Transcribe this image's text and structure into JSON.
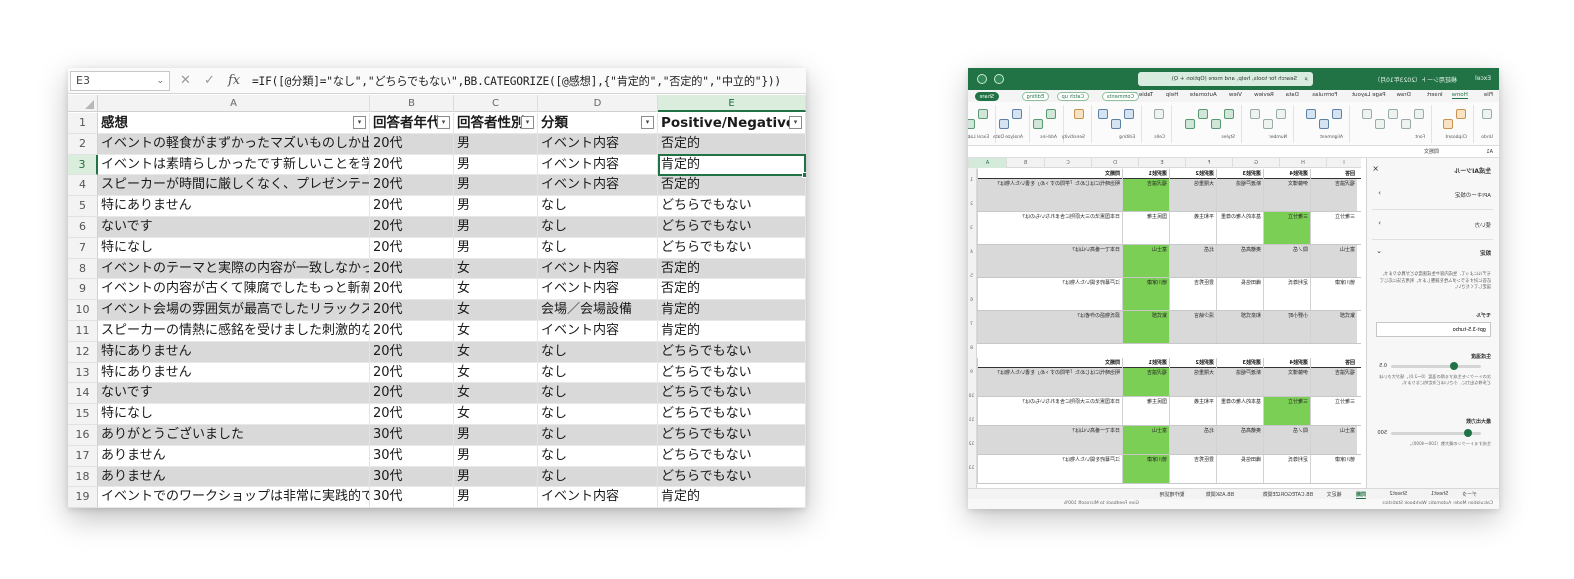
{
  "left": {
    "name_box": "E3",
    "formula_icons": [
      "cancel-icon",
      "enter-check-icon",
      "function-icon"
    ],
    "fx_label": "fx",
    "formula": "=IF([@分類]=\"なし\",\"どちらでもない\",BB.CATEGORIZE([@感想],{\"肯定的\",\"否定的\",\"中立的\"}))",
    "columns": [
      "A",
      "B",
      "C",
      "D",
      "E"
    ],
    "selected_column": "E",
    "header_row": {
      "num": "1",
      "cells": [
        "感想",
        "回答者年代",
        "回答者性別",
        "分類",
        "Positive/Negative"
      ]
    },
    "rows": [
      {
        "num": "2",
        "cells": [
          "イベントの軽食がまずかったマズいものしか出",
          "20代",
          "男",
          "イベント内容",
          "否定的"
        ]
      },
      {
        "num": "3",
        "cells": [
          "イベントは素晴らしかったです新しいことを学",
          "20代",
          "男",
          "イベント内容",
          "肯定的"
        ]
      },
      {
        "num": "4",
        "cells": [
          "スピーカーが時間に厳しくなく、プレゼンテー",
          "20代",
          "男",
          "イベント内容",
          "否定的"
        ]
      },
      {
        "num": "5",
        "cells": [
          "特にありません",
          "20代",
          "男",
          "なし",
          "どちらでもない"
        ]
      },
      {
        "num": "6",
        "cells": [
          "ないです",
          "20代",
          "男",
          "なし",
          "どちらでもない"
        ]
      },
      {
        "num": "7",
        "cells": [
          "特になし",
          "20代",
          "男",
          "なし",
          "どちらでもない"
        ]
      },
      {
        "num": "8",
        "cells": [
          "イベントのテーマと実際の内容が一致しなかっ",
          "20代",
          "女",
          "イベント内容",
          "否定的"
        ]
      },
      {
        "num": "9",
        "cells": [
          "イベントの内容が古くて陳腐でしたもっと斬新",
          "20代",
          "女",
          "イベント内容",
          "否定的"
        ]
      },
      {
        "num": "10",
        "cells": [
          "イベント会場の雰囲気が最高でしたリラックス",
          "20代",
          "女",
          "会場／会場設備",
          "肯定的"
        ]
      },
      {
        "num": "11",
        "cells": [
          "スピーカーの情熱に感銘を受けました刺激的な",
          "20代",
          "女",
          "イベント内容",
          "肯定的"
        ]
      },
      {
        "num": "12",
        "cells": [
          "特にありません",
          "20代",
          "女",
          "なし",
          "どちらでもない"
        ]
      },
      {
        "num": "13",
        "cells": [
          "特にありません",
          "20代",
          "女",
          "なし",
          "どちらでもない"
        ]
      },
      {
        "num": "14",
        "cells": [
          "ないです",
          "20代",
          "女",
          "なし",
          "どちらでもない"
        ]
      },
      {
        "num": "15",
        "cells": [
          "特になし",
          "20代",
          "女",
          "なし",
          "どちらでもない"
        ]
      },
      {
        "num": "16",
        "cells": [
          "ありがとうございました",
          "30代",
          "男",
          "なし",
          "どちらでもない"
        ]
      },
      {
        "num": "17",
        "cells": [
          "ありません",
          "30代",
          "男",
          "なし",
          "どちらでもない"
        ]
      },
      {
        "num": "18",
        "cells": [
          "ありません",
          "30代",
          "男",
          "なし",
          "どちらでもない"
        ]
      },
      {
        "num": "19",
        "cells": [
          "イベントでのワークショップは非常に実践的で",
          "30代",
          "男",
          "イベント内容",
          "肯定的"
        ]
      }
    ],
    "selected_cell": "E3",
    "accent": "#217346",
    "band_color": "#d9d9d9"
  },
  "right": {
    "title": "Excel",
    "workbook_title": "検証用シート（2023年10月）",
    "search_placeholder": "Search for tools, help, and more (Option + Q)",
    "tabs": [
      "File",
      "Home",
      "Insert",
      "Draw",
      "Page Layout",
      "Formulas",
      "Data",
      "Review",
      "View",
      "Automate",
      "Help",
      "Table Design"
    ],
    "active_tab": "Home",
    "pills": [
      "Comments",
      "Catch up",
      "Editing",
      "Share"
    ],
    "ribbon_groups": [
      "Undo",
      "Clipboard",
      "Font",
      "Alignment",
      "Number",
      "Styles",
      "Cells",
      "Editing",
      "Sensitivity",
      "Add-ins",
      "Analyze Data",
      "Excel Labs"
    ],
    "name_box": "A1",
    "formula_value": "問題文",
    "columns": [
      "A",
      "B",
      "C",
      "D",
      "E",
      "F",
      "G",
      "H",
      "I"
    ],
    "table_headers": [
      "問題文",
      "選択肢1",
      "選択肢2",
      "選択肢3",
      "選択肢4",
      "回答"
    ],
    "table1_rows": [
      {
        "cells": [
          "明治時代にはじめた「学問のすゝめ」を書いた人物は？",
          "福沢諭吉",
          "大隈重信",
          "新渡戸稲造",
          "伊藤博文",
          "福沢諭吉"
        ],
        "hl": 1
      },
      {
        "cells": [
          "日本国憲法の三大原則に含まれないものは？",
          "国民主権",
          "平和主義",
          "基本的人権の尊重",
          "三権分立",
          "三権分立"
        ],
        "hl": 4
      },
      {
        "cells": [
          "日本で一番高い山は？",
          "富士山",
          "北岳",
          "奥穂高岳",
          "間ノ岳",
          "富士山"
        ],
        "hl": 1
      },
      {
        "cells": [
          "江戸幕府を開いた人物は？",
          "徳川家康",
          "豊臣秀吉",
          "織田信長",
          "足利尊氏",
          "徳川家康"
        ],
        "hl": 1
      },
      {
        "cells": [
          "源氏物語の作者は？",
          "紫式部",
          "清少納言",
          "和泉式部",
          "小野小町",
          "紫式部"
        ],
        "hl": 1
      }
    ],
    "table2_rows": [
      {
        "cells": [
          "明治時代にはじめた「学問のすゝめ」を書いた人物は？",
          "福沢諭吉",
          "大隈重信",
          "新渡戸稲造",
          "伊藤博文",
          "福沢諭吉"
        ],
        "hl": 1
      },
      {
        "cells": [
          "日本国憲法の三大原則に含まれないものは？",
          "国民主権",
          "平和主義",
          "基本的人権の尊重",
          "三権分立",
          "三権分立"
        ],
        "hl": 4
      },
      {
        "cells": [
          "日本で一番高い山は？",
          "富士山",
          "北岳",
          "奥穂高岳",
          "間ノ岳",
          "富士山"
        ],
        "hl": 1
      },
      {
        "cells": [
          "江戸幕府を開いた人物は？",
          "徳川家康",
          "豊臣秀吉",
          "織田信長",
          "足利尊氏",
          "徳川家康"
        ],
        "hl": 1
      }
    ],
    "pane": {
      "title": "生成AIツール",
      "close": "×",
      "sections": [
        "APIキーの設定",
        "使い方",
        "設定"
      ],
      "description": "モデルによって、生成内容や生成速度などが異なります。応答に対するランダム性を調整します。利用方法に応じて設定してください。",
      "model_label": "モデル",
      "model_value": "gpt-3.5-turbo",
      "temperature_label": "生成温度",
      "temperature_value": "0.5",
      "temperature_level": 0.25,
      "temperature_help": "次のトークンを生成する際の温度（0〜2.0）。値が大きいほど多様な出力に、小さいほど決定的になります。",
      "max_tokens_label": "最大出力数",
      "max_tokens_value": "500",
      "max_tokens_level": 0.1,
      "max_tokens_help": "生成するトークンの最大数（100〜4000）。"
    },
    "sheet_tabs": [
      "データ",
      "Sheet1",
      "Sheet2",
      "問題",
      "補足文",
      "BB.CATEGORIZE関数",
      "BB.ASK関数",
      "動作確認用"
    ],
    "active_sheet": "問題",
    "status_left": "Calculation Mode: Automatic   Workbook Statistics",
    "status_right": "Give Feedback to Microsoft   100%",
    "highlight_color": "#7ccf55"
  }
}
